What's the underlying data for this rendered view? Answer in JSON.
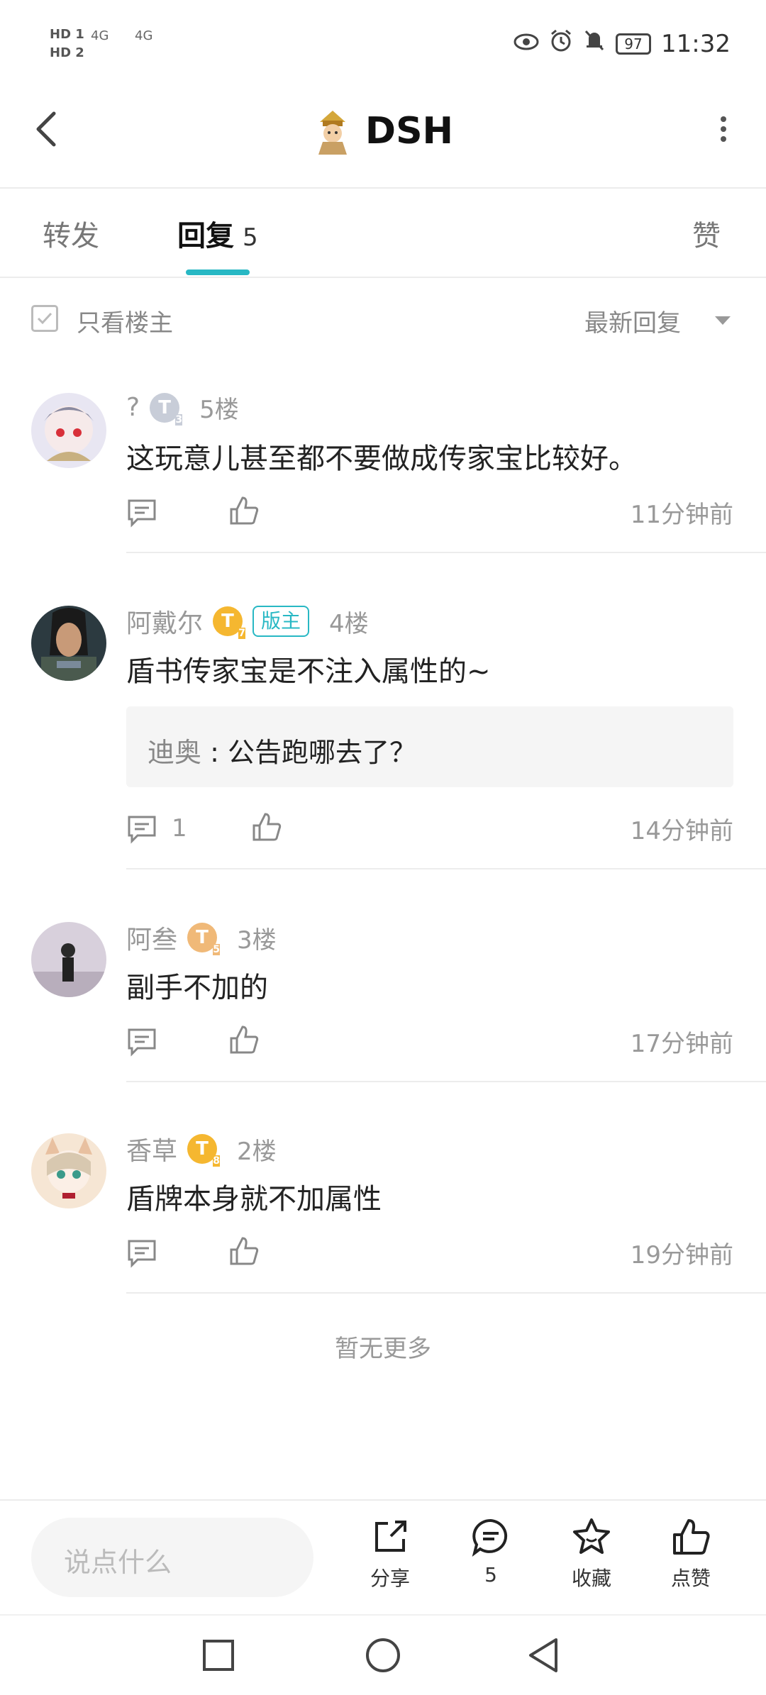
{
  "status_bar": {
    "hd1": "HD 1",
    "hd2": "HD 2",
    "signal1": "4G",
    "signal2": "4G",
    "battery": "97",
    "time": "11:32"
  },
  "header": {
    "title": "DSH"
  },
  "tabs": [
    {
      "label": "转发"
    },
    {
      "label": "回复",
      "count": "5"
    },
    {
      "label": "赞"
    }
  ],
  "filter": {
    "only_op_label": "只看楼主",
    "sort_label": "最新回复"
  },
  "comments": [
    {
      "name": "?",
      "level": "T",
      "level_sub": "3",
      "floor": "5楼",
      "text": "这玩意儿甚至都不要做成传家宝比较好。",
      "time": "11分钟前",
      "reply_count": ""
    },
    {
      "name": "阿戴尔",
      "level": "T",
      "level_sub": "7",
      "mod_badge": "版主",
      "floor": "4楼",
      "text": "盾书传家宝是不注入属性的~",
      "quote_author": "迪奥",
      "quote_text": "公告跑哪去了？",
      "time": "14分钟前",
      "reply_count": "1"
    },
    {
      "name": "阿叁",
      "level": "T",
      "level_sub": "5",
      "floor": "3楼",
      "text": "副手不加的",
      "time": "17分钟前",
      "reply_count": ""
    },
    {
      "name": "香草",
      "level": "T",
      "level_sub": "8",
      "floor": "2楼",
      "text": "盾牌本身就不加属性",
      "time": "19分钟前",
      "reply_count": ""
    }
  ],
  "no_more": "暂无更多",
  "bottom_bar": {
    "input_placeholder": "说点什么",
    "share_label": "分享",
    "comment_count": "5",
    "favorite_label": "收藏",
    "like_label": "点赞"
  },
  "colors": {
    "accent": "#28b8c4",
    "badge_gold": "#f5b730",
    "badge_silver": "#c8cdd8",
    "badge_bronze": "#f0b978"
  }
}
